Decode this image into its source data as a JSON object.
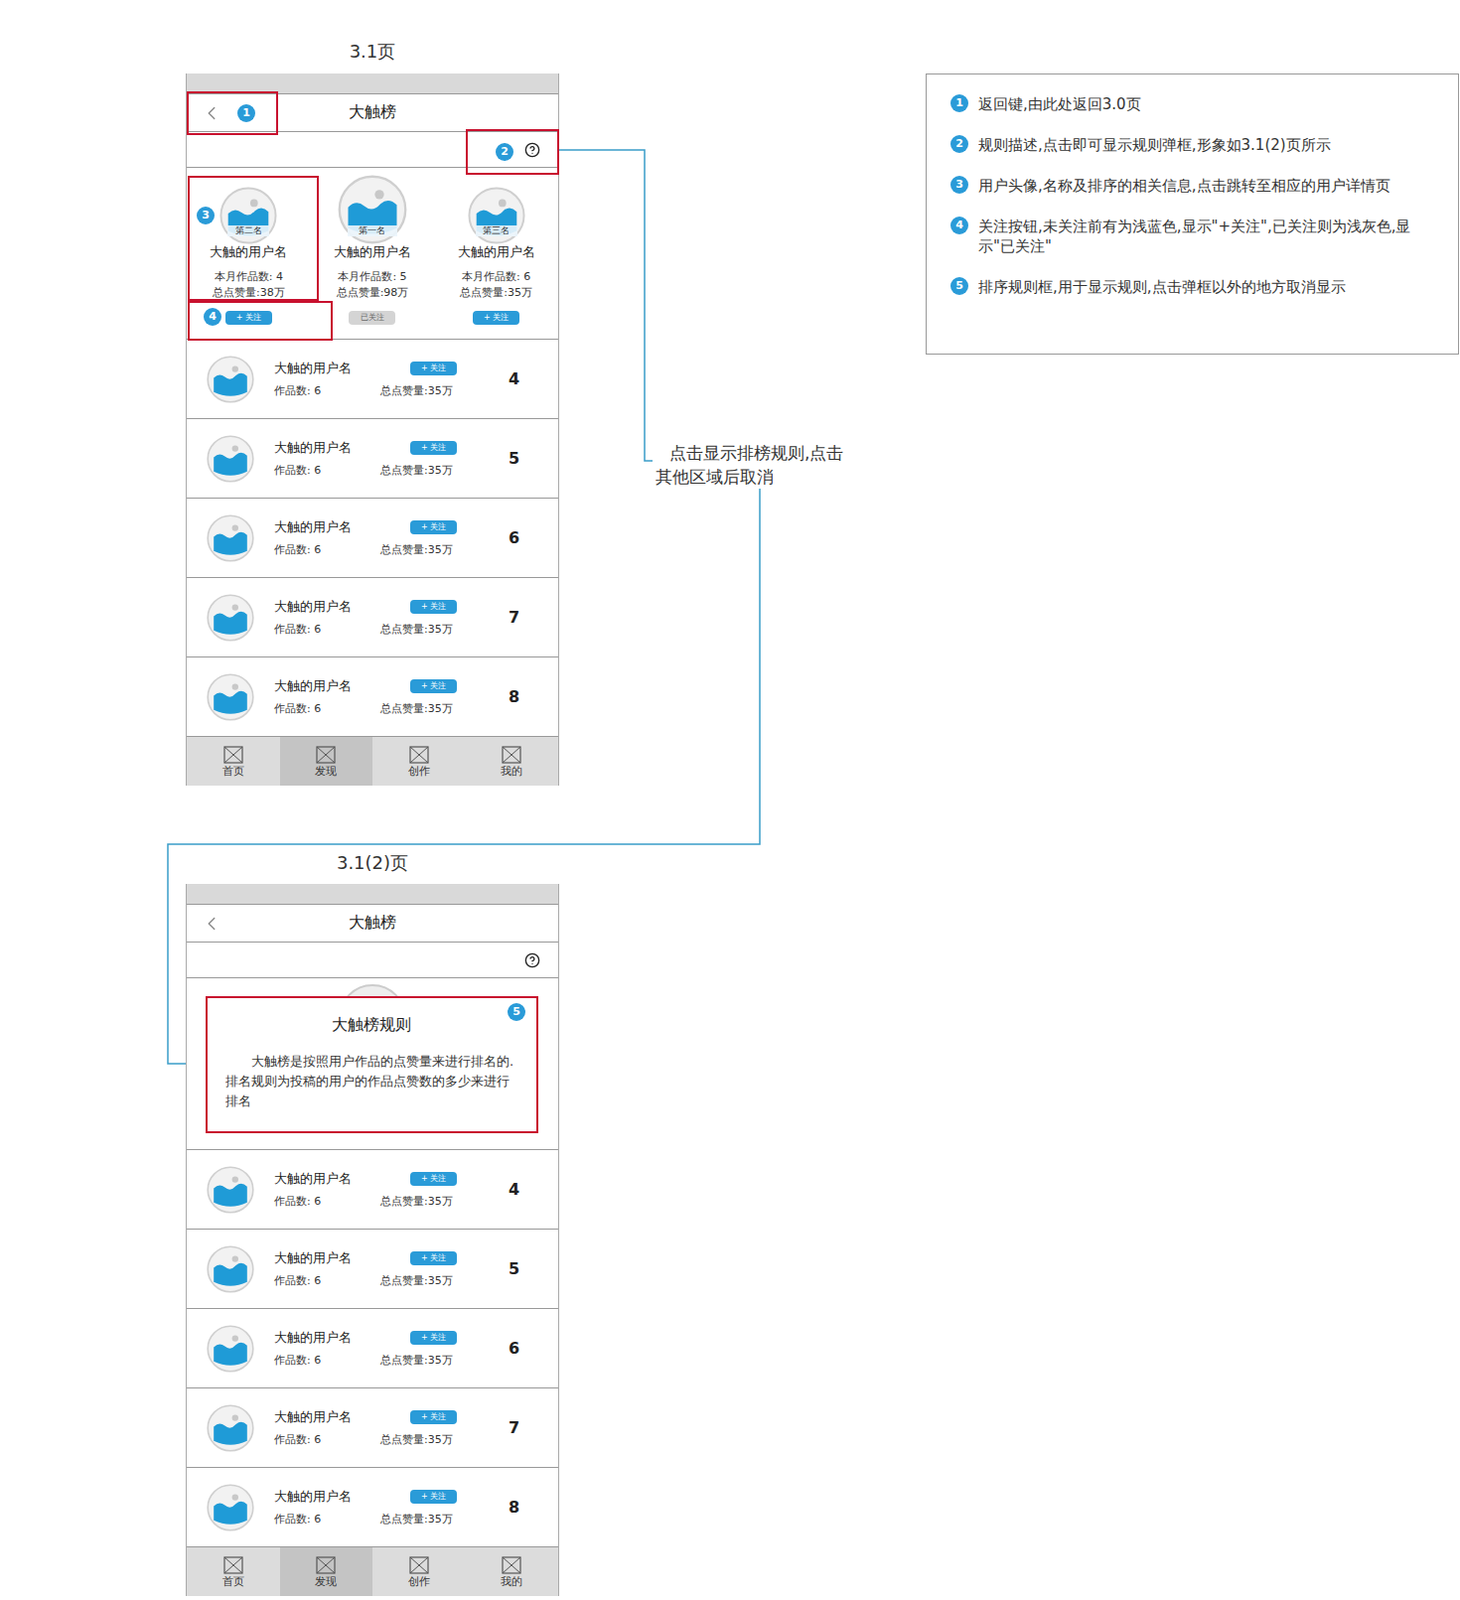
{
  "diagram": {
    "connector_label": [
      "点击显示排榜规则,点击",
      "其他区域后取消"
    ]
  },
  "notes": [
    {
      "num": "1",
      "text": "返回键,由此处返回3.0页"
    },
    {
      "num": "2",
      "text": "规则描述,点击即可显示规则弹框,形象如3.1(2)页所示"
    },
    {
      "num": "3",
      "text": "用户头像,名称及排序的相关信息,点击跳转至相应的用户详情页"
    },
    {
      "num": "4",
      "text": "关注按钮,未关注前有为浅蓝色,显示\"+关注\",已关注则为浅灰色,显示\"已关注\""
    },
    {
      "num": "5",
      "text": "排序规则框,用于显示规则,点击弹框以外的地方取消显示"
    }
  ],
  "page1": {
    "caption": "3.1页",
    "title": "大触榜",
    "markers": {
      "back": "1",
      "help": "2",
      "user": "3",
      "follow": "4"
    },
    "top3": [
      {
        "rank_label": "第二名",
        "name": "大触的用户名",
        "works": "本月作品数: 4",
        "likes": "总点赞量:38万",
        "follow": "+ 关注",
        "followed": false
      },
      {
        "rank_label": "第一名",
        "name": "大触的用户名",
        "works": "本月作品数: 5",
        "likes": "总点赞量:98万",
        "follow": "已关注",
        "followed": true
      },
      {
        "rank_label": "第三名",
        "name": "大触的用户名",
        "works": "本月作品数: 6",
        "likes": "总点赞量:35万",
        "follow": "+ 关注",
        "followed": false
      }
    ],
    "list": [
      {
        "name": "大触的用户名",
        "works": "作品数: 6",
        "likes": "总点赞量:35万",
        "follow": "+ 关注",
        "followed": false,
        "rank": "4"
      },
      {
        "name": "大触的用户名",
        "works": "作品数: 6",
        "likes": "总点赞量:35万",
        "follow": "+ 关注",
        "followed": false,
        "rank": "5"
      },
      {
        "name": "大触的用户名",
        "works": "作品数: 6",
        "likes": "总点赞量:35万",
        "follow": "+ 关注",
        "followed": false,
        "rank": "6"
      },
      {
        "name": "大触的用户名",
        "works": "作品数: 6",
        "likes": "总点赞量:35万",
        "follow": "+ 关注",
        "followed": false,
        "rank": "7"
      },
      {
        "name": "大触的用户名",
        "works": "作品数: 6",
        "likes": "总点赞量:35万",
        "follow": "+ 关注",
        "followed": false,
        "rank": "8"
      }
    ],
    "tabs": [
      {
        "label": "首页",
        "selected": false
      },
      {
        "label": "发现",
        "selected": true
      },
      {
        "label": "创作",
        "selected": false
      },
      {
        "label": "我的",
        "selected": false
      }
    ]
  },
  "page2": {
    "caption": "3.1(2)页",
    "title": "大触榜",
    "popup": {
      "marker": "5",
      "title": "大触榜规则",
      "body": "大触榜是按照用户作品的点赞量来进行排名的.排名规则为投稿的用户的作品点赞数的多少来进行排名"
    },
    "list": [
      {
        "name": "大触的用户名",
        "works": "作品数: 6",
        "likes": "总点赞量:35万",
        "follow": "+ 关注",
        "followed": false,
        "rank": "4"
      },
      {
        "name": "大触的用户名",
        "works": "作品数: 6",
        "likes": "总点赞量:35万",
        "follow": "+ 关注",
        "followed": false,
        "rank": "5"
      },
      {
        "name": "大触的用户名",
        "works": "作品数: 6",
        "likes": "总点赞量:35万",
        "follow": "+ 关注",
        "followed": false,
        "rank": "6"
      },
      {
        "name": "大触的用户名",
        "works": "作品数: 6",
        "likes": "总点赞量:35万",
        "follow": "+ 关注",
        "followed": false,
        "rank": "7"
      },
      {
        "name": "大触的用户名",
        "works": "作品数: 6",
        "likes": "总点赞量:35万",
        "follow": "+ 关注",
        "followed": false,
        "rank": "8"
      }
    ],
    "tabs": [
      {
        "label": "首页",
        "selected": false
      },
      {
        "label": "发现",
        "selected": true
      },
      {
        "label": "创作",
        "selected": false
      },
      {
        "label": "我的",
        "selected": false
      }
    ]
  }
}
